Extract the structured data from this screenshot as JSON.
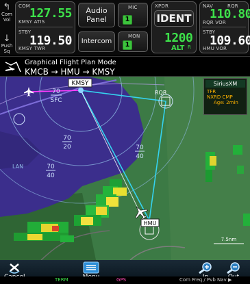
{
  "top": {
    "com_swap_label": "Com\nVol",
    "push_sq_label": "Push\nSq",
    "com_active_label": "COM",
    "com_active_freq": "127.55",
    "com_active_id": "KMSY ATIS",
    "com_stby_label": "STBY",
    "com_stby_freq": "119.50",
    "com_stby_id": "KMSY TWR",
    "audio_panel_label_1": "Audio",
    "audio_panel_label_2": "Panel",
    "intercom_label": "Intercom",
    "mic_label": "MIC",
    "mic_value": "1",
    "mon_label": "MON",
    "mon_value": "1",
    "xpdr_label": "XPDR",
    "xpdr_mode": "IDENT",
    "xpdr_code": "1200",
    "xpdr_alt": "ALT",
    "xpdr_r": "R",
    "nav_label": "NAV",
    "nav_id_top": "RQR",
    "nav_active_freq": "110.80",
    "nav_active_id": "RQR VOR",
    "nav_stby_label": "STBY",
    "nav_stby_freq": "109.60",
    "nav_stby_id": "HMU VOR"
  },
  "flightplan": {
    "mode_title": "Graphical Flight Plan Mode",
    "route": "KMCB → HMU → KMSY"
  },
  "map": {
    "kmsy_label": "KMSY",
    "hmu_label": "HMU",
    "rqr_label": "RQR",
    "sfc_top": "70",
    "sfc_bottom": "SFC",
    "alt1_top": "70",
    "alt1_bottom": "20",
    "alt2_top": "70",
    "alt2_bottom": "40",
    "alt3_top": "70",
    "alt3_bottom": "40",
    "range_label": "7.5nm",
    "lake_label": "LAN",
    "siriusxm_title": "SiriusXM",
    "siriusxm_tfr": "TFR",
    "siriusxm_nxrd": "NXRD CMP",
    "siriusxm_age": "Age: 2min"
  },
  "bottom": {
    "cancel_label": "Cancel",
    "menu_label": "Menu",
    "in_label": "In",
    "out_label": "Out",
    "tab_term": "TERM",
    "tab_gps": "GPS",
    "hint": "Com Freq / Pvb Nav ▶"
  }
}
